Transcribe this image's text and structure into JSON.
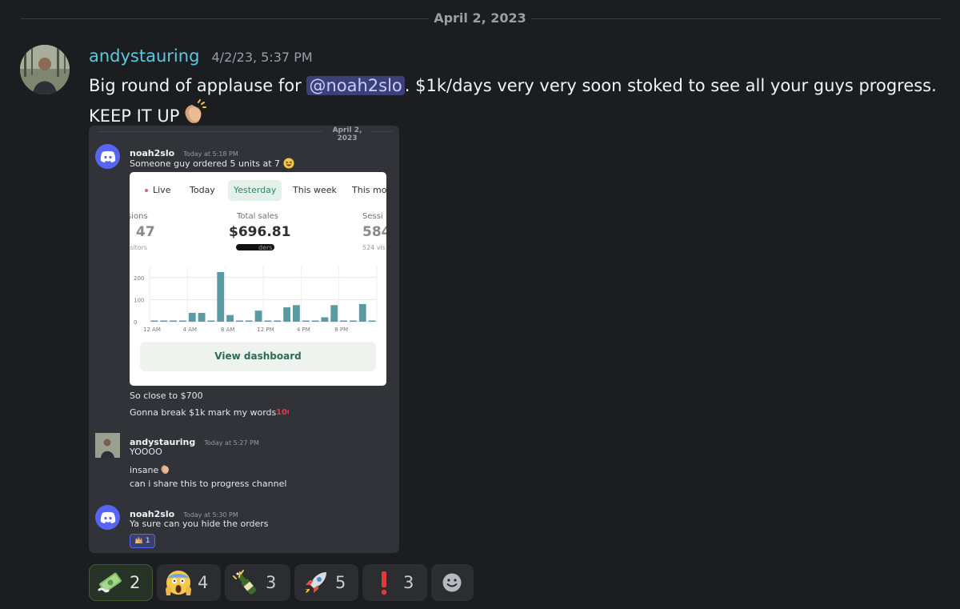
{
  "divider": {
    "date": "April 2, 2023"
  },
  "message": {
    "author": "andystauring",
    "timestamp": "4/2/23, 5:37 PM",
    "text_before": "Big round of applause for ",
    "mention": "@noah2slo",
    "text_after": ". $1k/days very very soon stoked to see all your guys progress.",
    "text_line2": "KEEP IT UP",
    "emoji": "clapping-hands"
  },
  "embed": {
    "divider_date": "April 2, 2023",
    "msg1": {
      "author": "noah2slo",
      "time": "Today at 5:18 PM",
      "line1": "Someone guy ordered 5 units at 7",
      "line2": "So close to $700",
      "line3": "Gonna break $1k mark my words"
    },
    "card": {
      "tabs": [
        "Live",
        "Today",
        "Yesterday",
        "This week",
        "This mor"
      ],
      "selected_tab": "Yesterday",
      "left_label": "sions",
      "left_value": "47",
      "left_sub": "isitors",
      "center_label": "Total sales",
      "center_value": "$696.81",
      "center_sub": "ders",
      "right_label": "Sessi",
      "right_value": "584",
      "right_sub": "524 vis",
      "y_ticks": [
        "200",
        "100",
        "0"
      ],
      "x_ticks": [
        "12 AM",
        "4 AM",
        "8 AM",
        "12 PM",
        "4 PM",
        "8 PM"
      ],
      "button": "View dashboard"
    },
    "msg2": {
      "author": "andystauring",
      "time": "Today at 5:27 PM",
      "line1": "YOOOO",
      "line2": "insane",
      "line3": "can i share this to progress channel"
    },
    "msg3": {
      "author": "noah2slo",
      "time": "Today at 5:30 PM",
      "line1": "Ya sure can you hide the orders",
      "reaction_count": "1"
    }
  },
  "chart_data": {
    "type": "bar",
    "x": [
      "12 AM",
      "1 AM",
      "2 AM",
      "3 AM",
      "4 AM",
      "5 AM",
      "6 AM",
      "7 AM",
      "8 AM",
      "9 AM",
      "10 AM",
      "11 AM",
      "12 PM",
      "1 PM",
      "2 PM",
      "3 PM",
      "4 PM",
      "5 PM",
      "6 PM",
      "7 PM",
      "8 PM",
      "9 PM",
      "10 PM",
      "11 PM"
    ],
    "values": [
      0,
      0,
      0,
      0,
      40,
      40,
      0,
      225,
      30,
      0,
      0,
      50,
      0,
      0,
      65,
      75,
      0,
      0,
      20,
      75,
      0,
      0,
      80,
      0
    ],
    "ylim": [
      0,
      250
    ],
    "y_ticks": [
      0,
      100,
      200
    ],
    "grid": true
  },
  "reactions": [
    {
      "emoji": "money-with-wings",
      "count": "2",
      "active": true
    },
    {
      "emoji": "face-screaming",
      "count": "4",
      "active": false
    },
    {
      "emoji": "champagne-celebration",
      "count": "3",
      "active": false
    },
    {
      "emoji": "rocket",
      "count": "5",
      "active": false
    },
    {
      "emoji": "exclamation",
      "count": "3",
      "active": false
    }
  ],
  "add_reaction": {
    "icon": "smiley-add"
  }
}
